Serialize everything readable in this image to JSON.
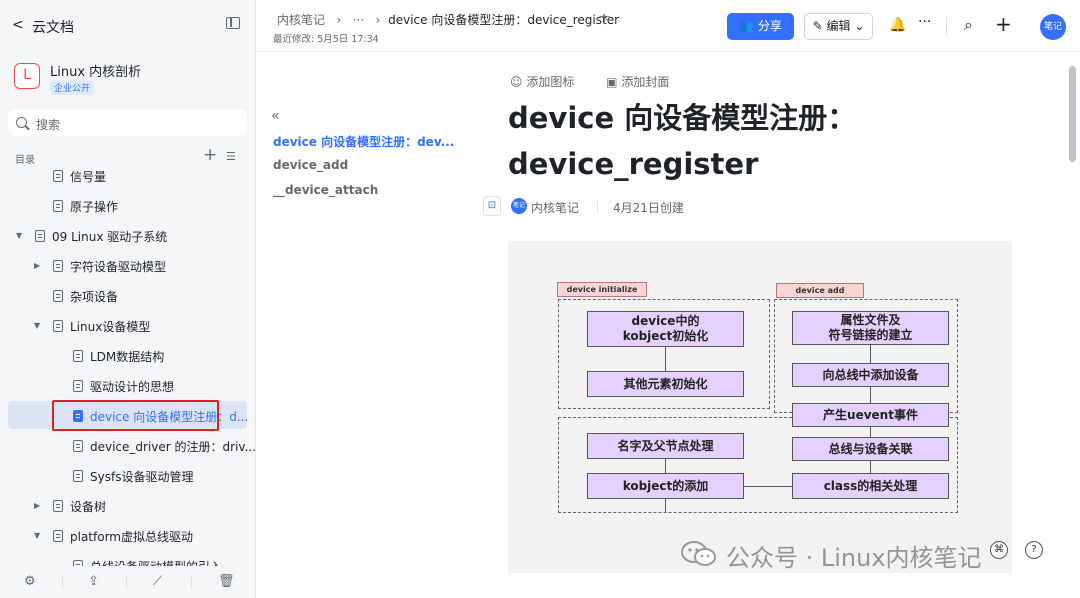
{
  "sidebar": {
    "back_label": "云文档",
    "space": {
      "logo_letter": "L",
      "name": "Linux 内核剖析",
      "badge": "企业公开"
    },
    "search_placeholder": "搜索",
    "toc_label": "目录",
    "tree": [
      {
        "label": "信号量",
        "level": 2,
        "caret": ""
      },
      {
        "label": "原子操作",
        "level": 2,
        "caret": ""
      },
      {
        "label": "09 Linux 驱动子系统",
        "level": 1,
        "caret": "▼"
      },
      {
        "label": "字符设备驱动模型",
        "level": 2,
        "caret": "▶"
      },
      {
        "label": "杂项设备",
        "level": 2,
        "caret": ""
      },
      {
        "label": "Linux设备模型",
        "level": 2,
        "caret": "▼"
      },
      {
        "label": "LDM数据结构",
        "level": 3,
        "caret": ""
      },
      {
        "label": "驱动设计的思想",
        "level": 3,
        "caret": ""
      },
      {
        "label": "device 向设备模型注册：d...",
        "level": 3,
        "caret": "",
        "active": true
      },
      {
        "label": "device_driver 的注册：driv...",
        "level": 3,
        "caret": ""
      },
      {
        "label": "Sysfs设备驱动管理",
        "level": 3,
        "caret": ""
      },
      {
        "label": "设备树",
        "level": 2,
        "caret": "▶"
      },
      {
        "label": "platform虚拟总线驱动",
        "level": 2,
        "caret": "▼"
      },
      {
        "label": "总线设备驱动模型的引入",
        "level": 3,
        "caret": ""
      }
    ]
  },
  "topbar": {
    "breadcrumb_root": "内核笔记",
    "breadcrumb_more": "···",
    "breadcrumb_current": "device 向设备模型注册：device_register",
    "last_modified": "最近修改: 5月5日 17:34",
    "share_label": "分享",
    "edit_label": "编辑",
    "avatar_text": "笔记"
  },
  "outline": {
    "items": [
      {
        "label": "device 向设备模型注册：dev...",
        "active": true
      },
      {
        "label": "device_add",
        "active": false
      },
      {
        "label": "__device_attach",
        "active": false
      }
    ]
  },
  "document": {
    "add_icon_label": "添加图标",
    "add_cover_label": "添加封面",
    "title_line1": "device 向设备模型注册：",
    "title_line2": "device_register",
    "author_avatar": "笔记",
    "author": "内核笔记",
    "created": "4月21日创建",
    "figure": {
      "tag_initialize": "device initialize",
      "tag_add": "device add",
      "box_kobject_init": "device中的\nkobject初始化",
      "box_other_init": "其他元素初始化",
      "box_name": "名字及父节点处理",
      "box_kobject_add": "kobject的添加",
      "box_attr": "属性文件及\n符号链接的建立",
      "box_bus_add": "向总线中添加设备",
      "box_uevent": "产生uevent事件",
      "box_bus_link": "总线与设备关联",
      "box_class": "class的相关处理"
    },
    "watermark": "公众号 · Linux内核笔记"
  },
  "colors": {
    "accent": "#3370ff",
    "highlight_border": "#e0201e",
    "box_fill": "#e5d1ff",
    "tag_fill": "#fbd5d5"
  }
}
